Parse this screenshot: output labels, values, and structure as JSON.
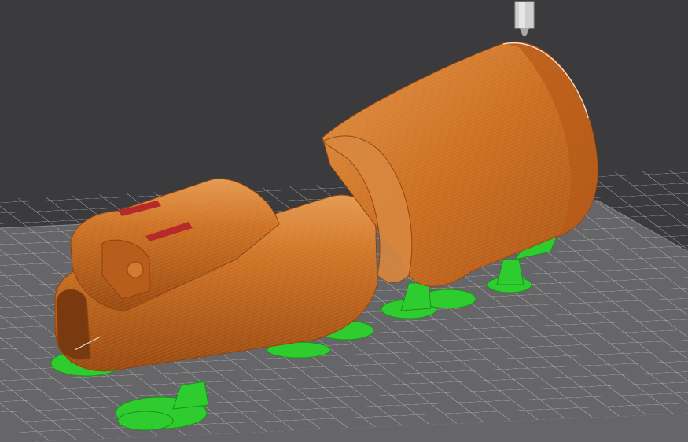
{
  "viewport": {
    "background": "#3b3b3d",
    "bed_color": "#6a6a6c",
    "grid_color": "#d9d9d9"
  },
  "model": {
    "body_color": "#c8681d",
    "body_highlight": "#e08a3e",
    "body_shadow": "#8f4310",
    "support_color": "#2fd12f",
    "support_dark": "#1b8f1b",
    "accent_color": "#b62a2a"
  },
  "nozzle": {
    "color": "#c9c9c9"
  }
}
